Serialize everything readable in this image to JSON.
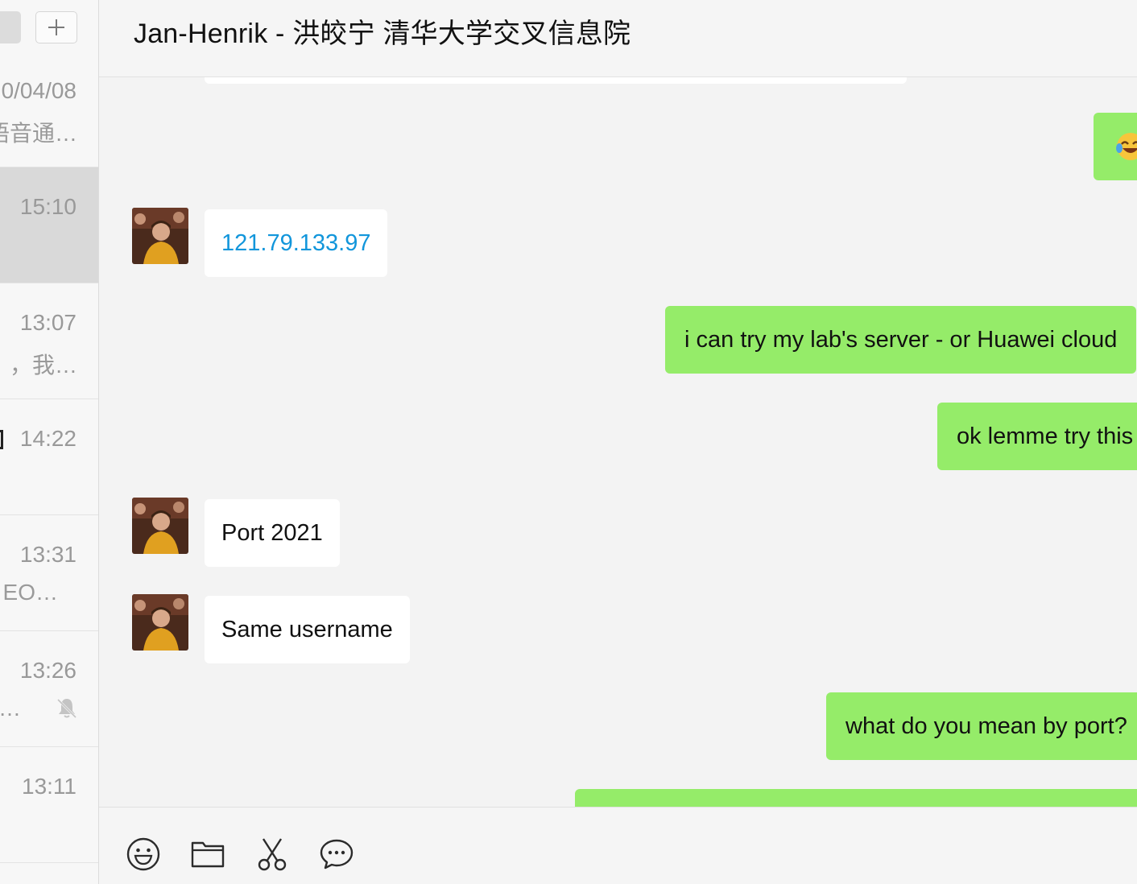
{
  "sidebar": {
    "add_label": "+",
    "conversations": [
      {
        "time": "0/04/08",
        "preview": "语音通…",
        "selected": false,
        "muted": false
      },
      {
        "time": "15:10",
        "preview": "",
        "selected": true,
        "muted": false
      },
      {
        "time": "13:07",
        "preview": "，我…",
        "selected": false,
        "muted": false
      },
      {
        "time": "14:22",
        "preview": "",
        "selected": false,
        "muted": false
      },
      {
        "time": "13:31",
        "preview": "EO…",
        "selected": false,
        "muted": false
      },
      {
        "time": "13:26",
        "preview": "l…",
        "selected": false,
        "muted": true
      },
      {
        "time": "13:11",
        "preview": "",
        "selected": false,
        "muted": false
      }
    ]
  },
  "chat": {
    "title": "Jan-Henrik - 洪皎宁 清华大学交叉信息院",
    "messages": [
      {
        "direction": "in",
        "text": ""
      },
      {
        "direction": "out",
        "text": "😂"
      },
      {
        "direction": "in",
        "text": "121.79.133.97",
        "is_link": true
      },
      {
        "direction": "out",
        "text": "i can try my lab's server - or Huawei cloud"
      },
      {
        "direction": "out",
        "text": "ok lemme try this"
      },
      {
        "direction": "in",
        "text": "Port 2021"
      },
      {
        "direction": "in",
        "text": "Same username"
      },
      {
        "direction": "out",
        "text": "what do you mean by port?"
      },
      {
        "direction": "out",
        "text": ""
      }
    ]
  },
  "toolbar": {
    "icons": [
      "smiley-icon",
      "folder-icon",
      "scissors-icon",
      "chat-bubble-icon"
    ]
  },
  "colors": {
    "outgoing_bubble": "#95ec69",
    "incoming_bubble": "#ffffff",
    "link": "#1296db",
    "selected_conversation": "#d9d9d9"
  }
}
